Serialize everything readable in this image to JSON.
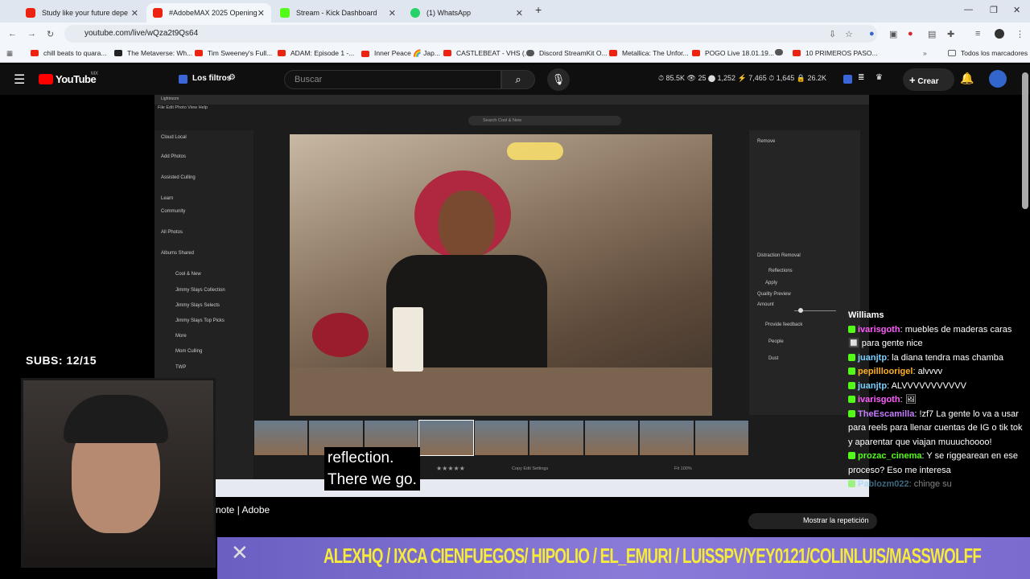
{
  "tabs": [
    {
      "label": "Study like your future depe",
      "color": "#e21"
    },
    {
      "label": "#AdobeMAX 2025 Opening",
      "color": "#e21"
    },
    {
      "label": "Stream - Kick Dashboard",
      "color": "#53fc18"
    },
    {
      "label": "(1) WhatsApp",
      "color": "#25d366"
    }
  ],
  "url": "youtube.com/live/wQza2t9Qs64",
  "bookmarks": [
    "chill beats to quara...",
    "The Metaverse: Wh...",
    "Tim Sweeney's Full...",
    "ADAM: Episode 1 -...",
    "Inner Peace 🌈 Jap...",
    "CASTLEBEAT - VHS (...",
    "Discord StreamKit O...",
    "Metallica: The Unfor...",
    "POGO Live 18.01.19...",
    "10 PRIMEROS PASO...",
    "Todos los marcadores"
  ],
  "yt": {
    "logo": "YouTube",
    "region": "MX",
    "filters": "Los filtros",
    "search_placeholder": "Buscar",
    "stats": "⏱ 85.5K   👁 25   ⬤ 1,252   ⚡ 7,465   ⏱ 1,645   🔒 26.2K",
    "create": "Crear"
  },
  "lightroom": {
    "title": "Lightroom",
    "menu": "File  Edit  Photo  View  Help",
    "search": "Search Cool & New",
    "left": [
      "Cloud   Local",
      "Add Photos",
      "Assisted Culling",
      "Learn",
      "Community",
      "All Photos",
      "Albums   Shared",
      "Cool & New",
      "Jimmy Slays Collection",
      "Jimmy Slays Selects",
      "Jimmy Slays Top Picks",
      "More",
      "Mom Culling",
      "TWP"
    ],
    "right": [
      "Remove",
      "Distraction Removal",
      "Reflections",
      "Apply",
      "Quality  Preview",
      "Amount",
      "Provide feedback",
      "People",
      "Dust"
    ],
    "filmbar": "Copy Edit Settings",
    "fit": "Fit  100%"
  },
  "caption": {
    "line1": "reflection.",
    "line2": "There we go."
  },
  "subs": "SUBS: 12/15",
  "keynote": "note | Adobe",
  "replay": "Mostrar la repetición",
  "chat": [
    {
      "user": "Williams",
      "text": "",
      "color": "#fff"
    },
    {
      "user": "ivarisgoth",
      "text": ": muebles de maderas caras 🔲 para gente nice",
      "color": "#ff5cff"
    },
    {
      "user": "juanjtp",
      "text": ": la diana tendra mas chamba",
      "color": "#7ad0ff"
    },
    {
      "user": "pepillloorigel",
      "text": ": alvvvv",
      "color": "#ffb020"
    },
    {
      "user": "juanjtp",
      "text": ": ALVVVVVVVVVVV",
      "color": "#7ad0ff"
    },
    {
      "user": "ivarisgoth",
      "text": ": 🖼",
      "color": "#ff5cff"
    },
    {
      "user": "TheEscamilla",
      "text": ": !zf7 La gente lo va a usar para reels para llenar cuentas de IG o tik tok y aparentar que viajan muuuchoooo!",
      "color": "#c77dff"
    },
    {
      "user": "prozac_cinema",
      "text": ": Y se riggearean en ese proceso? Eso me interesa",
      "color": "#53fc18"
    },
    {
      "user": "Pablozm022",
      "text": ": chinge su",
      "color": "#7ad0ff"
    }
  ],
  "banner": "ALEXHQ / IXCA CIENFUEGOS/ HIPOLIO / EL_EMURI / LUISSPV/YEY0121/COLINLUIS/MASSWOLFF"
}
